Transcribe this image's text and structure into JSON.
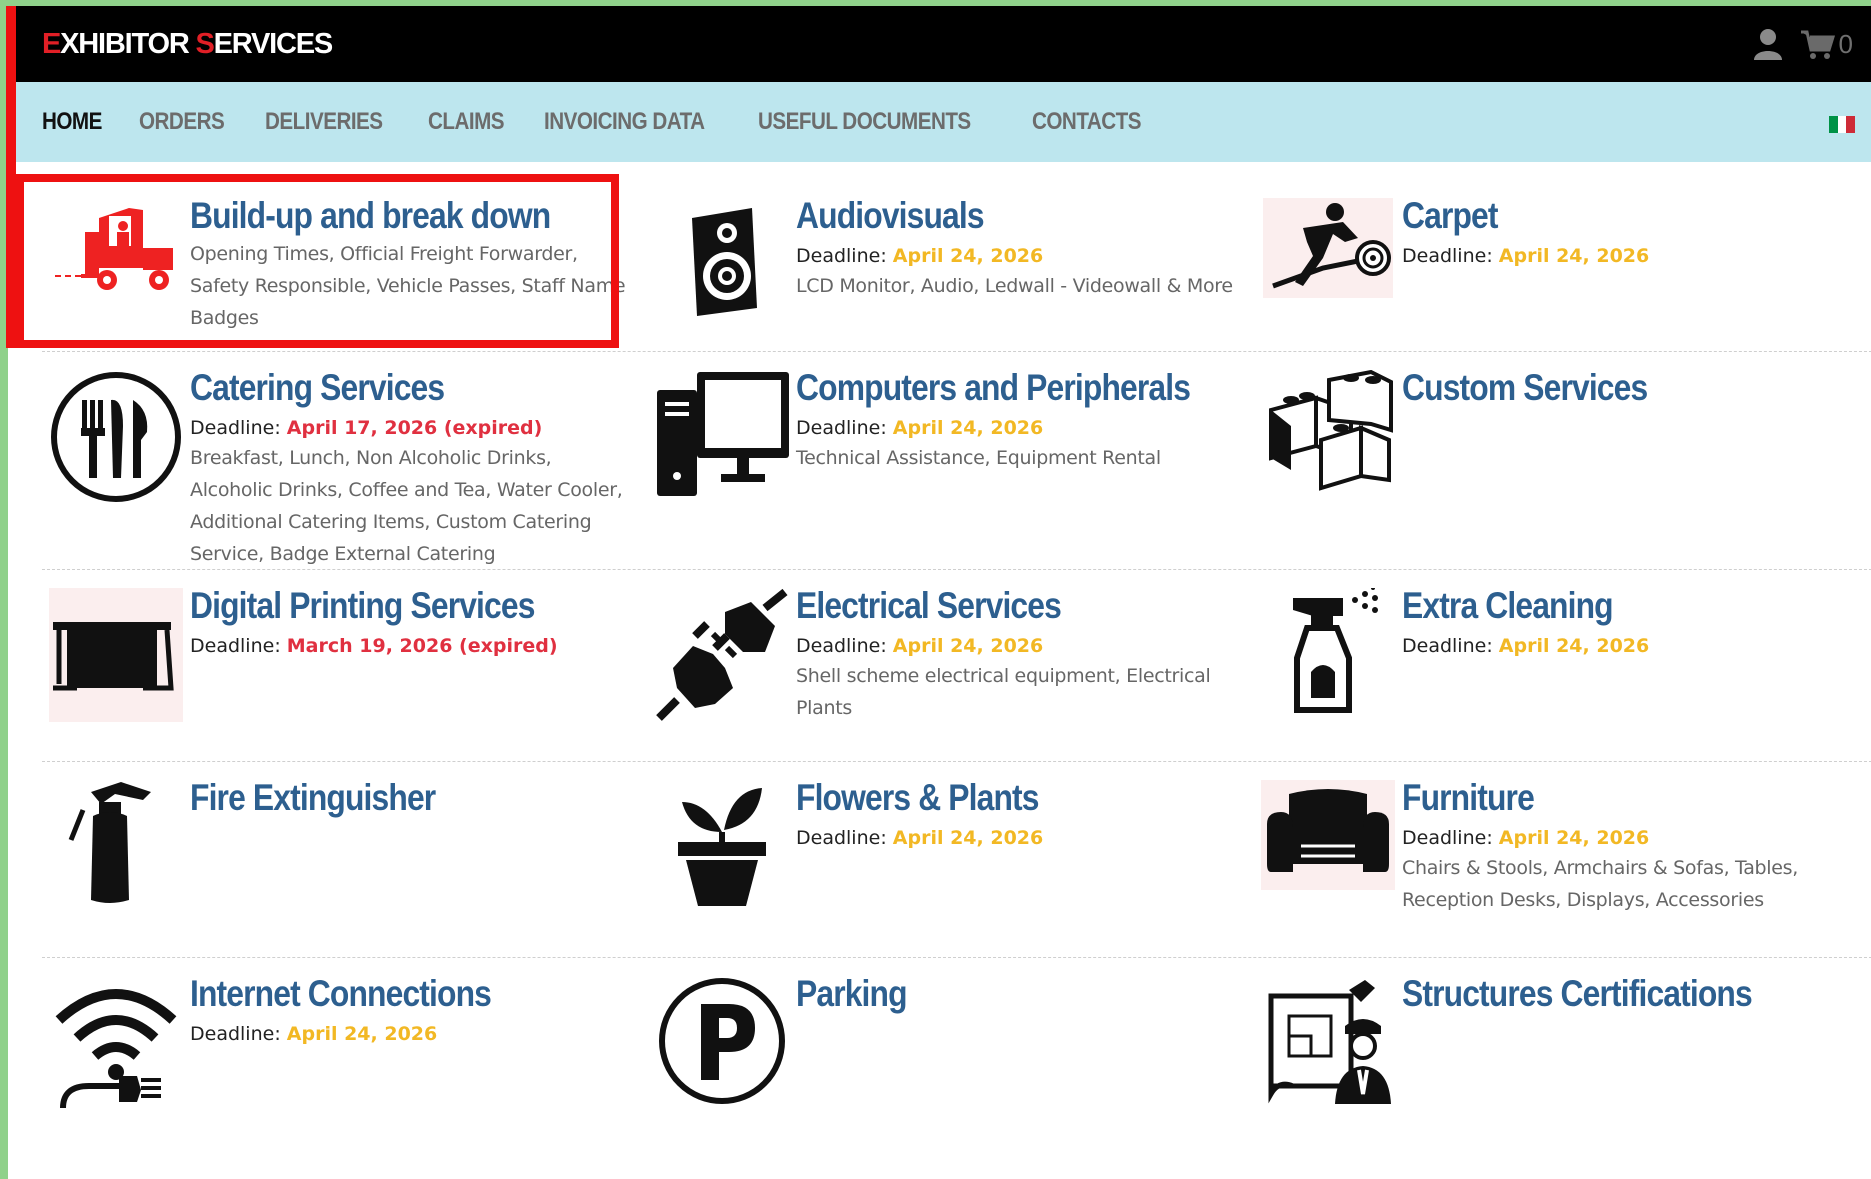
{
  "header": {
    "logo_first_letter_1": "E",
    "logo_rest_1": "XHIBITOR ",
    "logo_first_letter_2": "S",
    "logo_rest_2": "ERVICES",
    "cart_count": "0",
    "brand_color": "#e11f26"
  },
  "nav": {
    "items": [
      "HOME",
      "ORDERS",
      "DELIVERIES",
      "CLAIMS",
      "INVOICING DATA",
      "USEFUL DOCUMENTS",
      "CONTACTS"
    ],
    "active": "HOME",
    "background": "#bde6ee",
    "language_flag": "it-flag"
  },
  "deadline_label": "Deadline:",
  "services": [
    {
      "title": "Build-up and break down",
      "deadline": "",
      "expired": false,
      "desc": "Opening Times, Official Freight Forwarder, Safety Responsible, Vehicle Passes, Staff Name Badges",
      "icon": "forklift-icon"
    },
    {
      "title": "Audiovisuals",
      "deadline": "April 24, 2026",
      "expired": false,
      "desc": "LCD Monitor, Audio, Ledwall - Videowall & More",
      "icon": "speaker-icon"
    },
    {
      "title": "Carpet",
      "deadline": "April 24, 2026",
      "expired": false,
      "desc": "",
      "icon": "carpet-roll-icon"
    },
    {
      "title": "Catering Services",
      "deadline": "April 17, 2026 (expired)",
      "expired": true,
      "desc": "Breakfast, Lunch, Non Alcoholic Drinks, Alcoholic Drinks, Coffee and Tea, Water Cooler, Additional Catering Items, Custom Catering Service, Badge External Catering",
      "icon": "cutlery-icon"
    },
    {
      "title": "Computers and Peripherals",
      "deadline": "April 24, 2026",
      "expired": false,
      "desc": "Technical Assistance, Equipment Rental",
      "icon": "computer-icon"
    },
    {
      "title": "Custom Services",
      "deadline": "",
      "expired": false,
      "desc": "",
      "icon": "blocks-icon"
    },
    {
      "title": "Digital Printing Services",
      "deadline": "March 19, 2026 (expired)",
      "expired": true,
      "desc": "",
      "icon": "printer-icon"
    },
    {
      "title": "Electrical Services",
      "deadline": "April 24, 2026",
      "expired": false,
      "desc": "Shell scheme electrical equipment, Electrical Plants",
      "icon": "plug-icon"
    },
    {
      "title": "Extra Cleaning",
      "deadline": "April 24, 2026",
      "expired": false,
      "desc": "",
      "icon": "spray-bottle-icon"
    },
    {
      "title": "Fire Extinguisher",
      "deadline": "",
      "expired": false,
      "desc": "",
      "icon": "fire-extinguisher-icon"
    },
    {
      "title": "Flowers & Plants",
      "deadline": "April 24, 2026",
      "expired": false,
      "desc": "",
      "icon": "plant-pot-icon"
    },
    {
      "title": "Furniture",
      "deadline": "April 24, 2026",
      "expired": false,
      "desc": "Chairs & Stools, Armchairs & Sofas, Tables, Reception Desks, Displays, Accessories",
      "icon": "sofa-icon"
    },
    {
      "title": "Internet Connections",
      "deadline": "April 24, 2026",
      "expired": false,
      "desc": "",
      "icon": "wifi-icon"
    },
    {
      "title": "Parking",
      "deadline": "",
      "expired": false,
      "desc": "",
      "icon": "parking-icon"
    },
    {
      "title": "Structures Certifications",
      "deadline": "",
      "expired": false,
      "desc": "",
      "icon": "engineer-blueprint-icon"
    }
  ],
  "colors": {
    "title": "#2d5f8f",
    "deadline_ok": "#f2b824",
    "deadline_expired": "#e03040",
    "highlight": "#ee1111"
  }
}
